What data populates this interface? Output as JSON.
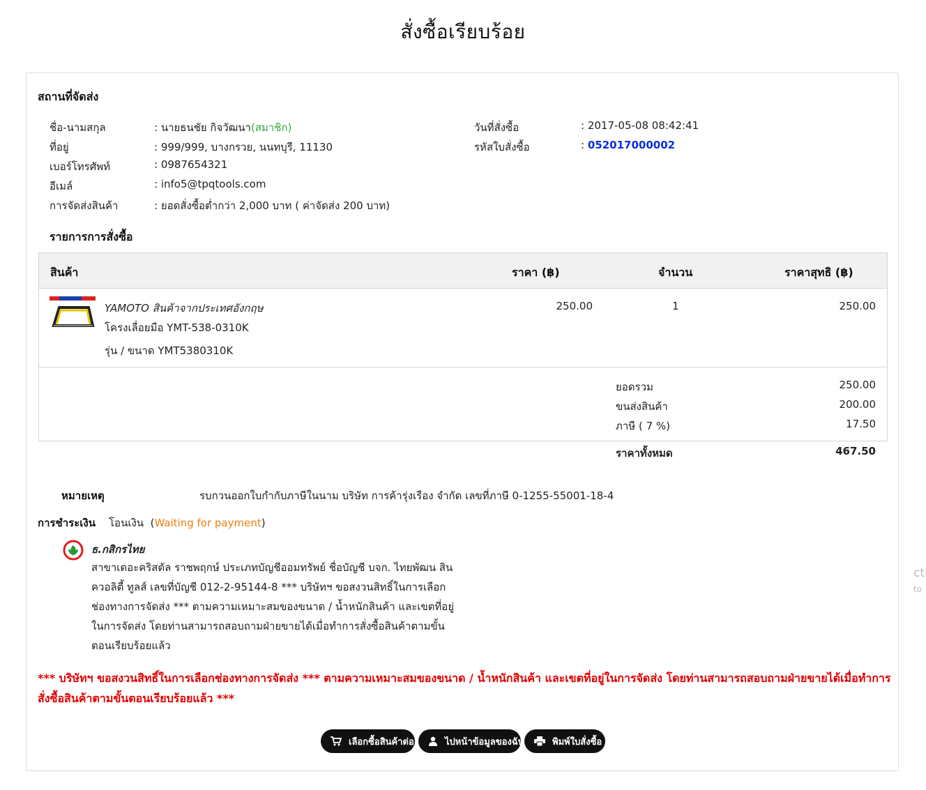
{
  "page": {
    "title": "สั่งซื้อเรียบร้อย"
  },
  "shipping": {
    "heading": "สถานที่จัดส่ง",
    "name_label": "ชื่อ-นามสกุล",
    "name_value": ": นายธนชัย กิจวัฒนา",
    "member_tag": "(สมาชิก)",
    "address_label": "ที่อยู่",
    "address_value": ": 999/999, บางกรวย, นนทบุรี, 11130",
    "phone_label": "เบอร์โทรศัพท์",
    "phone_value": ": 0987654321",
    "email_label": "อีเมล์",
    "email_value": ": info5@tpqtools.com",
    "delivery_label": "การจัดส่งสินค้า",
    "delivery_value": ": ยอดสั่งซื้อต่ำกว่า 2,000 บาท ( ค่าจัดส่ง 200 บาท)",
    "date_label": "วันที่สั่งซื้อ",
    "date_value": ": 2017-05-08 08:42:41",
    "order_no_label": "รหัสใบสั่งซื้อ",
    "order_no_colon": ":",
    "order_no_value": "052017000002"
  },
  "order": {
    "heading": "รายการการสั่งซื้อ",
    "columns": {
      "product": "สินค้า",
      "price": "ราคา (฿)",
      "qty": "จำนวน",
      "net": "ราคาสุทธิ (฿)"
    },
    "items": [
      {
        "brand": "YAMOTO สินค้าจากประเทศอังกฤษ",
        "name": "โครงเลื่อยมือ YMT-538-0310K",
        "model": "รุ่น / ขนาด  YMT5380310K",
        "price": "250.00",
        "qty": "1",
        "net": "250.00"
      }
    ],
    "summary": {
      "subtotal_label": "ยอดรวม",
      "subtotal": "250.00",
      "shipping_label": "ขนส่งสินค้า",
      "shipping": "200.00",
      "vat_label": "ภาษี ( 7 %)",
      "vat": "17.50",
      "total_label": "ราคาทั้งหมด",
      "total": "467.50"
    }
  },
  "note": {
    "label": "หมายเหตุ",
    "text": "รบกวนออกใบกำกับภาษีในนาม บริษัท การค้ารุ่งเรือง จำกัด เลขที่ภาษี 0-1255-55001-18-4"
  },
  "payment": {
    "label": "การชำระเงิน",
    "method": "โอนเงิน",
    "status_open": "(",
    "status": "Waiting for payment",
    "status_close": ")",
    "bank_name": "ธ.กสิกรไทย",
    "bank_desc": "สาขาเดอะคริสตัล ราชพฤกษ์ ประเภทบัญชีออมทรัพย์ ชื่อบัญชี บจก. ไทยพัฒน สิน ควอลิตี้ ทูลส์ เลขที่บัญชี 012-2-95144-8 *** บริษัทฯ ขอสงวนสิทธิ์ในการเลือกช่องทางการจัดส่ง *** ตามความเหมาะสมของขนาด / น้ำหนักสินค้า และเขตที่อยู่ในการจัดส่ง โดยท่านสามารถสอบถามฝ่ายขายได้เมื่อทำการสั่งซื้อสินค้าตามขั้นตอนเรียบร้อยแล้ว"
  },
  "warning": "*** บริษัทฯ ขอสงวนสิทธิ์ในการเลือกช่องทางการจัดส่ง *** ตามความเหมาะสมของขนาด / น้ำหนักสินค้า และเขตที่อยู่ในการจัดส่ง โดยท่านสามารถสอบถามฝ่ายขายได้เมื่อทำการสั่งซื้อสินค้าตามขั้นตอนเรียบร้อยแล้ว ***",
  "buttons": {
    "continue_shopping": "เลือกซื้อสินค้าต่อ",
    "my_profile": "ไปหน้าข้อมูลของฉัน",
    "print_order": "พิมพ์ใบสั่งซื้อ"
  },
  "side_fragment": {
    "line1": "cti",
    "line2": "to"
  },
  "colors": {
    "member": "#3aa63a",
    "order_link": "#0b2fd8",
    "status": "#f07d10",
    "warning": "#e40000",
    "button_bg": "#111111"
  },
  "icons": [
    "cart-icon",
    "user-icon",
    "printer-icon",
    "kasikorn-bank-logo-icon",
    "product-saw-image"
  ]
}
